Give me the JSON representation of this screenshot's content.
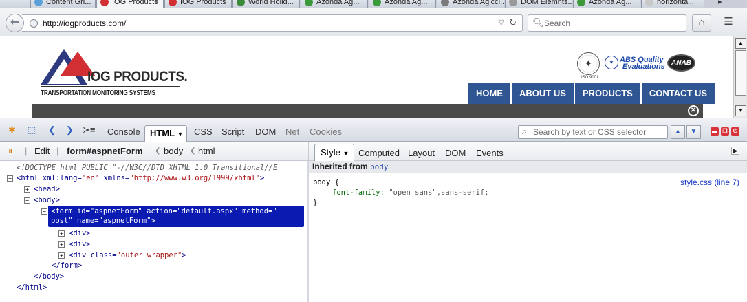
{
  "browser": {
    "tabs": [
      {
        "label": "Content Gri...",
        "selected": false
      },
      {
        "label": "IOG Products",
        "selected": true
      },
      {
        "label": "IOG Products",
        "selected": false
      },
      {
        "label": "World Holid...",
        "selected": false
      },
      {
        "label": "Azonda Ag...",
        "selected": false
      },
      {
        "label": "Azonda Ag...",
        "selected": false
      },
      {
        "label": "Azonda Agicci...",
        "selected": false
      },
      {
        "label": "DOM Elemnts...",
        "selected": false
      },
      {
        "label": "Azonda Ag...",
        "selected": false
      },
      {
        "label": "horizontal..",
        "selected": false
      }
    ],
    "url": "http://iogproducts.com/",
    "search_placeholder": "Search"
  },
  "site": {
    "logo_main": "IOG PRODUCTS.",
    "logo_sub": "TRANSPORTATION MONITORING SYSTEMS",
    "iso_label": "ISO 9001",
    "abs_line1": "ABS Quality",
    "abs_line2": "Evaluations",
    "anab": "ANAB",
    "menu": [
      "HOME",
      "ABOUT US",
      "PRODUCTS",
      "CONTACT US"
    ]
  },
  "firebug": {
    "tabs": [
      "Console",
      "HTML",
      "CSS",
      "Script",
      "DOM",
      "Net",
      "Cookies"
    ],
    "search_placeholder": "Search by text or CSS selector",
    "edit_label": "Edit",
    "breadcrumb": [
      "form#aspnetForm",
      "body",
      "html"
    ],
    "side_tabs": [
      "Style",
      "Computed",
      "Layout",
      "DOM",
      "Events"
    ],
    "tree": {
      "doctype": "<!DOCTYPE html PUBLIC \"-//W3C//DTD XHTML 1.0 Transitional//E",
      "html_open": "<html",
      "html_attrs": " xml:lang=",
      "html_lang": "\"en\"",
      "html_xmlns": " xmlns=",
      "html_xmlns_val": "\"http://www.w3.org/1999/xhtml\"",
      "html_close_bracket": ">",
      "head": "<head>",
      "body": "<body>",
      "form_line1": "<form id=\"aspnetForm\" action=\"default.aspx\" method=\"",
      "form_line2": "post\" name=\"aspnetForm\">",
      "div1": "<div>",
      "div2": "<div>",
      "div3_open": "<div class=",
      "div3_val": "\"outer_wrapper\"",
      "div3_close": ">",
      "form_end": "</form>",
      "body_end": "</body>",
      "html_end": "</html>"
    },
    "style": {
      "inherited_label": "Inherited from",
      "inherited_from": "body",
      "rule_selector": "body {",
      "rule_prop": "font-family:",
      "rule_value": "\"open sans\",sans-serif;",
      "rule_close": "}",
      "source": "style.css (line 7)"
    }
  }
}
